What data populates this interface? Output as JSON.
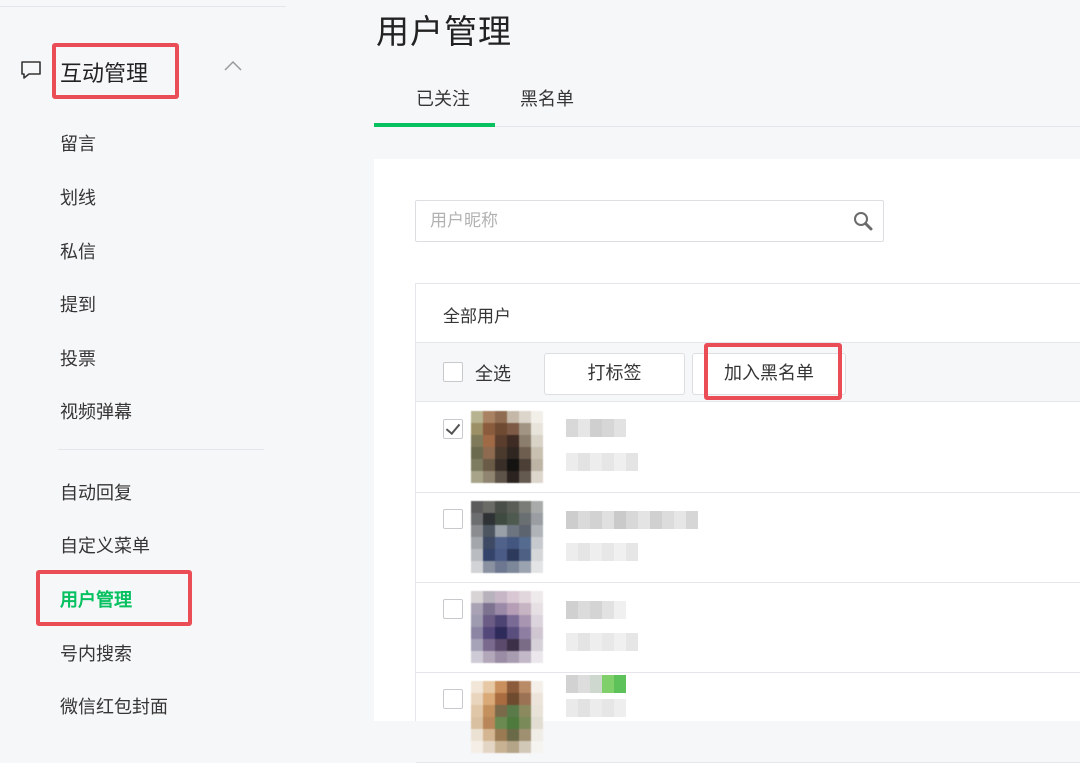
{
  "sidebar": {
    "group_title": "互动管理",
    "items_top": [
      "留言",
      "划线",
      "私信",
      "提到",
      "投票",
      "视频弹幕"
    ],
    "items_bottom": [
      "自动回复",
      "自定义菜单",
      "用户管理",
      "号内搜索",
      "微信红包封面"
    ],
    "active_item": "用户管理"
  },
  "main": {
    "page_title": "用户管理",
    "tabs": [
      "已关注",
      "黑名单"
    ],
    "active_tab": "已关注",
    "search": {
      "placeholder": "用户昵称",
      "value": ""
    },
    "table": {
      "header_title": "全部用户",
      "select_all_label": "全选",
      "tag_button": "打标签",
      "blacklist_button": "加入黑名单"
    },
    "rows": [
      {
        "checked": true
      },
      {
        "checked": false
      },
      {
        "checked": false
      },
      {
        "checked": false
      }
    ]
  },
  "colors": {
    "accent": "#07c160",
    "highlight": "#ea4d56",
    "background": "#f6f7f9"
  },
  "icons": [
    "chat-icon",
    "chevron-up-icon",
    "search-icon"
  ]
}
